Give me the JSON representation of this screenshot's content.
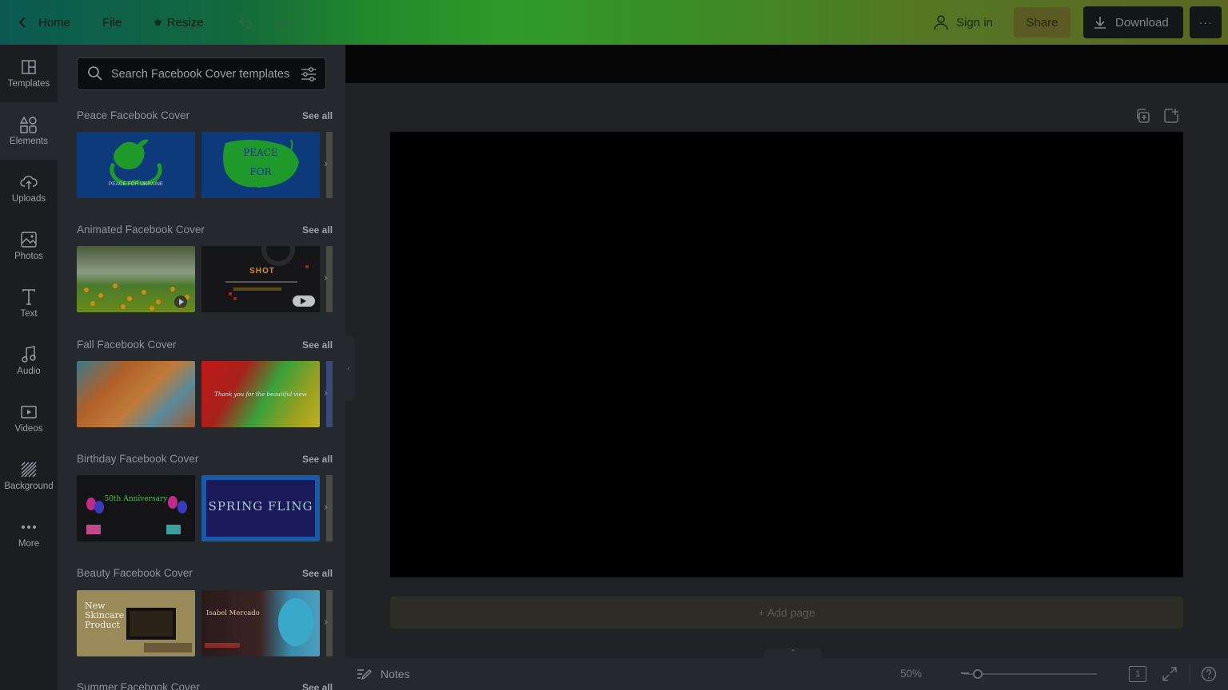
{
  "topbar": {
    "home": "Home",
    "file": "File",
    "resize": "Resize",
    "sign_in": "Sign in",
    "share": "Share",
    "download": "Download"
  },
  "rail": {
    "items": [
      {
        "label": "Templates",
        "icon": "templates-icon"
      },
      {
        "label": "Elements",
        "icon": "elements-icon"
      },
      {
        "label": "Uploads",
        "icon": "upload-cloud-icon"
      },
      {
        "label": "Photos",
        "icon": "photo-icon"
      },
      {
        "label": "Text",
        "icon": "text-icon"
      },
      {
        "label": "Audio",
        "icon": "music-note-icon"
      },
      {
        "label": "Videos",
        "icon": "video-icon"
      },
      {
        "label": "Background",
        "icon": "background-pattern-icon"
      },
      {
        "label": "More",
        "icon": "more-dots-icon"
      }
    ]
  },
  "panel": {
    "search_placeholder": "Search Facebook Cover templates",
    "see_all": "See all",
    "sections": [
      {
        "title": "Peace Facebook Cover",
        "thumbs": [
          {
            "text": "PEACE FOR UKRAINE"
          },
          {
            "text": "PEACE FOR UKRAINE"
          }
        ]
      },
      {
        "title": "Animated Facebook Cover",
        "thumbs": [
          {
            "text": ""
          },
          {
            "text": "SHOT"
          }
        ]
      },
      {
        "title": "Fall Facebook Cover",
        "thumbs": [
          {
            "text": ""
          },
          {
            "text": "Thank you for the beautiful view"
          }
        ]
      },
      {
        "title": "Birthday Facebook Cover",
        "thumbs": [
          {
            "text": "50th Anniversary"
          },
          {
            "text": "SPRING FLING"
          }
        ]
      },
      {
        "title": "Beauty Facebook Cover",
        "thumbs": [
          {
            "text": "New Skincare Product"
          },
          {
            "text": "Isabel Mercado"
          }
        ]
      },
      {
        "title": "Summer Facebook Cover",
        "thumbs": []
      }
    ]
  },
  "canvas": {
    "add_page": "+ Add page"
  },
  "bottombar": {
    "notes": "Notes",
    "zoom": "50%",
    "page_count": "1",
    "zoom_fraction": 0.1
  },
  "colors": {
    "topbar_gradient_start": "#0a5a52",
    "topbar_gradient_end": "#5a6622",
    "panel_bg": "#25282c",
    "rail_bg": "#1b1d20"
  }
}
